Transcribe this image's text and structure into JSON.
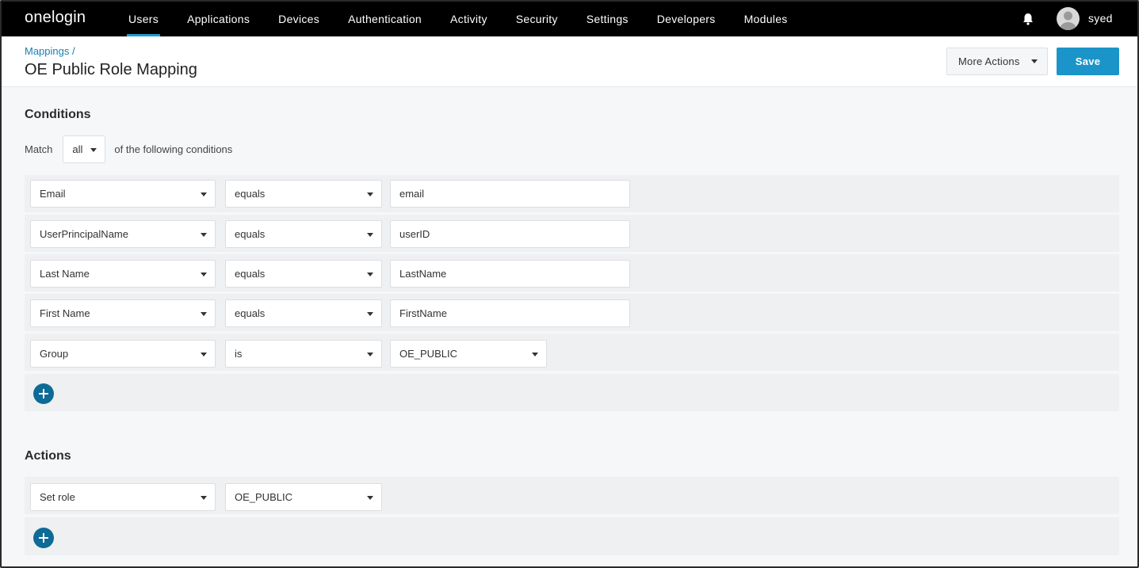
{
  "app": {
    "logo_text": "onelogin"
  },
  "nav": {
    "items": [
      {
        "label": "Users",
        "active": true
      },
      {
        "label": "Applications"
      },
      {
        "label": "Devices"
      },
      {
        "label": "Authentication"
      },
      {
        "label": "Activity"
      },
      {
        "label": "Security"
      },
      {
        "label": "Settings"
      },
      {
        "label": "Developers"
      },
      {
        "label": "Modules"
      }
    ],
    "username": "syed"
  },
  "header": {
    "breadcrumb": "Mappings /",
    "title": "OE Public Role Mapping",
    "more_actions_label": "More Actions",
    "save_label": "Save"
  },
  "conditions": {
    "heading": "Conditions",
    "match_label": "Match",
    "match_value": "all",
    "match_suffix": "of the following conditions",
    "rows": [
      {
        "field": "Email",
        "operator": "equals",
        "value": "email"
      },
      {
        "field": "UserPrincipalName",
        "operator": "equals",
        "value": "userID"
      },
      {
        "field": "Last Name",
        "operator": "equals",
        "value": "LastName"
      },
      {
        "field": "First Name",
        "operator": "equals",
        "value": "FirstName"
      },
      {
        "field": "Group",
        "operator": "is",
        "value": "OE_PUBLIC"
      }
    ]
  },
  "actions": {
    "heading": "Actions",
    "rows": [
      {
        "action": "Set role",
        "value": "OE_PUBLIC"
      }
    ]
  },
  "colors": {
    "nav_bg": "#000000",
    "accent": "#1b95c9",
    "add_button": "#0d6b96",
    "link": "#1a7eb3"
  },
  "icons": {
    "bell": "bell-icon",
    "avatar": "user-avatar-icon",
    "add": "plus-icon",
    "dropdown": "caret-down-icon"
  }
}
